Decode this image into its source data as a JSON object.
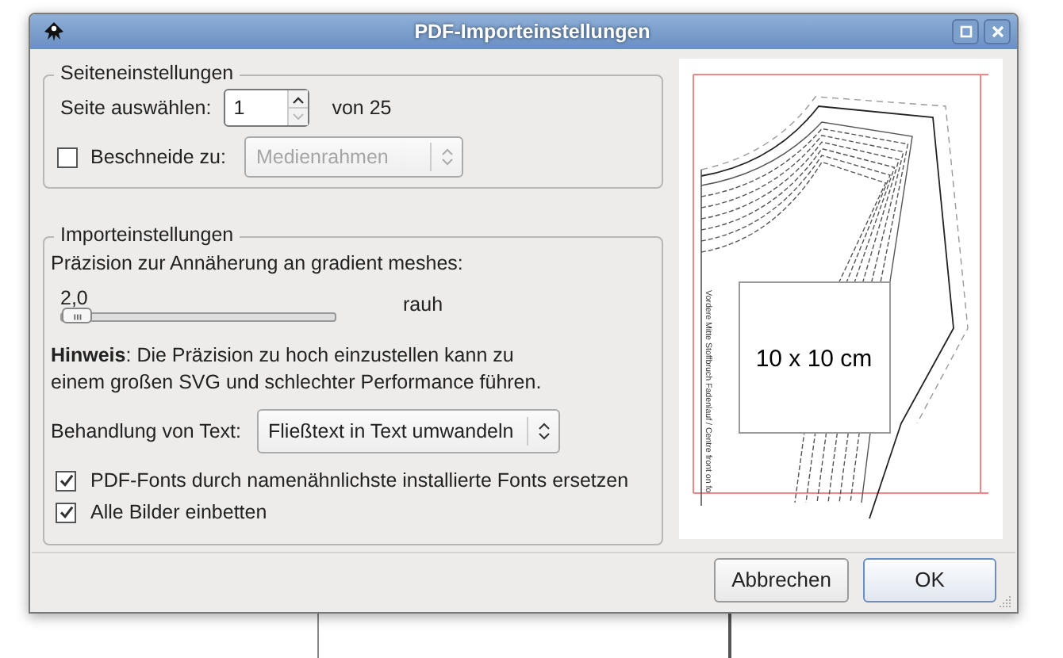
{
  "window": {
    "title": "PDF-Importeinstellungen"
  },
  "page_settings": {
    "title": "Seiteneinstellungen",
    "page_label": "Seite auswählen:",
    "page_value": "1",
    "page_total": "von 25",
    "crop": {
      "label": "Beschneide zu:",
      "checked": false,
      "value": "Medienrahmen",
      "disabled": true
    }
  },
  "import_settings": {
    "title": "Importeinstellungen",
    "precision_label": "Präzision zur Annäherung an gradient meshes:",
    "slider": {
      "reading": "2,0",
      "level": 0.0,
      "caption": "rauh"
    },
    "note": "**Hinweis**: Die Präzision zu hoch einzustellen kann zu einem großen SVG und schlechter Performance führen.",
    "text_handling": {
      "label": "Behandlung von Text:",
      "value": "Fließtext in Text umwandeln"
    },
    "options": [
      {
        "label": "PDF-Fonts durch namenähnlichste installierte Fonts ersetzen",
        "checked": true
      },
      {
        "label": "Alle Bilder einbetten",
        "checked": true
      }
    ]
  },
  "preview": {
    "box_label": "10 x 10 cm",
    "side_text": "Vordere Mitte Stoffbruch Fadenlauf / Centre front on fo"
  },
  "buttons": [
    {
      "label": "Abbrechen",
      "default": false
    },
    {
      "label": "OK",
      "default": true
    }
  ]
}
